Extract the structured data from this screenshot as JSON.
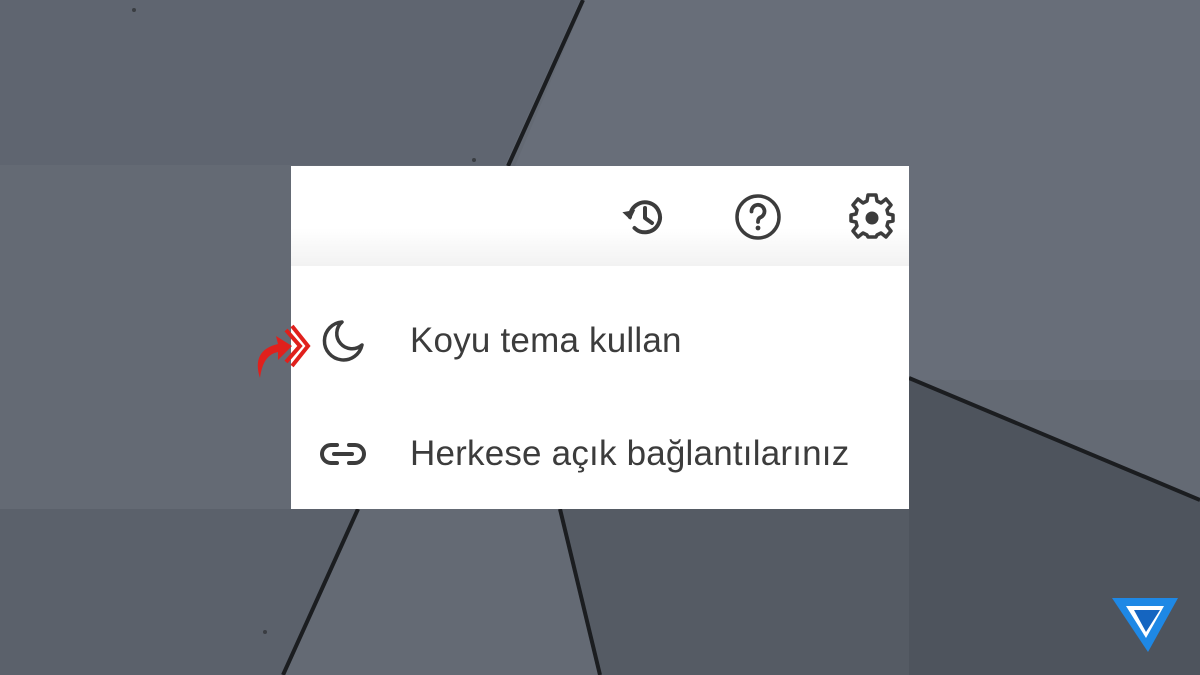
{
  "toolbar": {
    "icons": [
      {
        "name": "history-icon",
        "tooltip": ""
      },
      {
        "name": "help-icon",
        "tooltip": ""
      },
      {
        "name": "settings-icon",
        "tooltip": ""
      }
    ]
  },
  "menu": {
    "items": [
      {
        "icon": "moon-icon",
        "label": "Koyu tema kullan"
      },
      {
        "icon": "link-icon",
        "label": "Herkese açık bağlantılarınız"
      }
    ]
  },
  "colors": {
    "background": "#646a74",
    "panel": "#ffffff",
    "text": "#3c3c3c",
    "icon": "#3c3c3c",
    "pointer": "#e0201c",
    "logo": "#1e88e5"
  }
}
